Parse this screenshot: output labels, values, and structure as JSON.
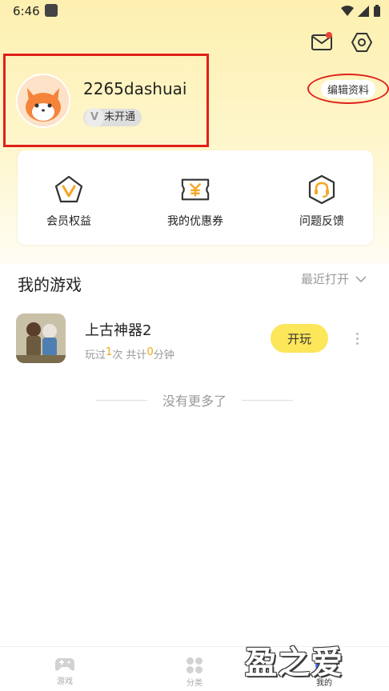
{
  "status_bar": {
    "time": "6:46"
  },
  "profile": {
    "username": "2265dashuai",
    "vip_status": "未开通",
    "vip_letter": "V",
    "edit_label": "编辑资料"
  },
  "quick_actions": [
    {
      "label": "会员权益",
      "icon": "vip-pentagon-icon"
    },
    {
      "label": "我的优惠券",
      "icon": "coupon-icon"
    },
    {
      "label": "问题反馈",
      "icon": "headset-icon"
    }
  ],
  "my_games": {
    "title": "我的游戏",
    "sort_label": "最近打开",
    "games": [
      {
        "name": "上古神器2",
        "stats_prefix": "玩过",
        "play_count": "1",
        "stats_mid": "次 共计",
        "minutes": "0",
        "stats_suffix": "分钟",
        "play_label": "开玩"
      }
    ],
    "no_more": "没有更多了"
  },
  "nav": [
    {
      "label": "游戏"
    },
    {
      "label": "分类"
    },
    {
      "label": "我的"
    }
  ],
  "watermark": "盈之爱",
  "colors": {
    "accent_yellow": "#fce65a",
    "highlight_orange": "#f2a51a",
    "annotation_red": "#e0201a",
    "icon_orange": "#f5a623"
  }
}
